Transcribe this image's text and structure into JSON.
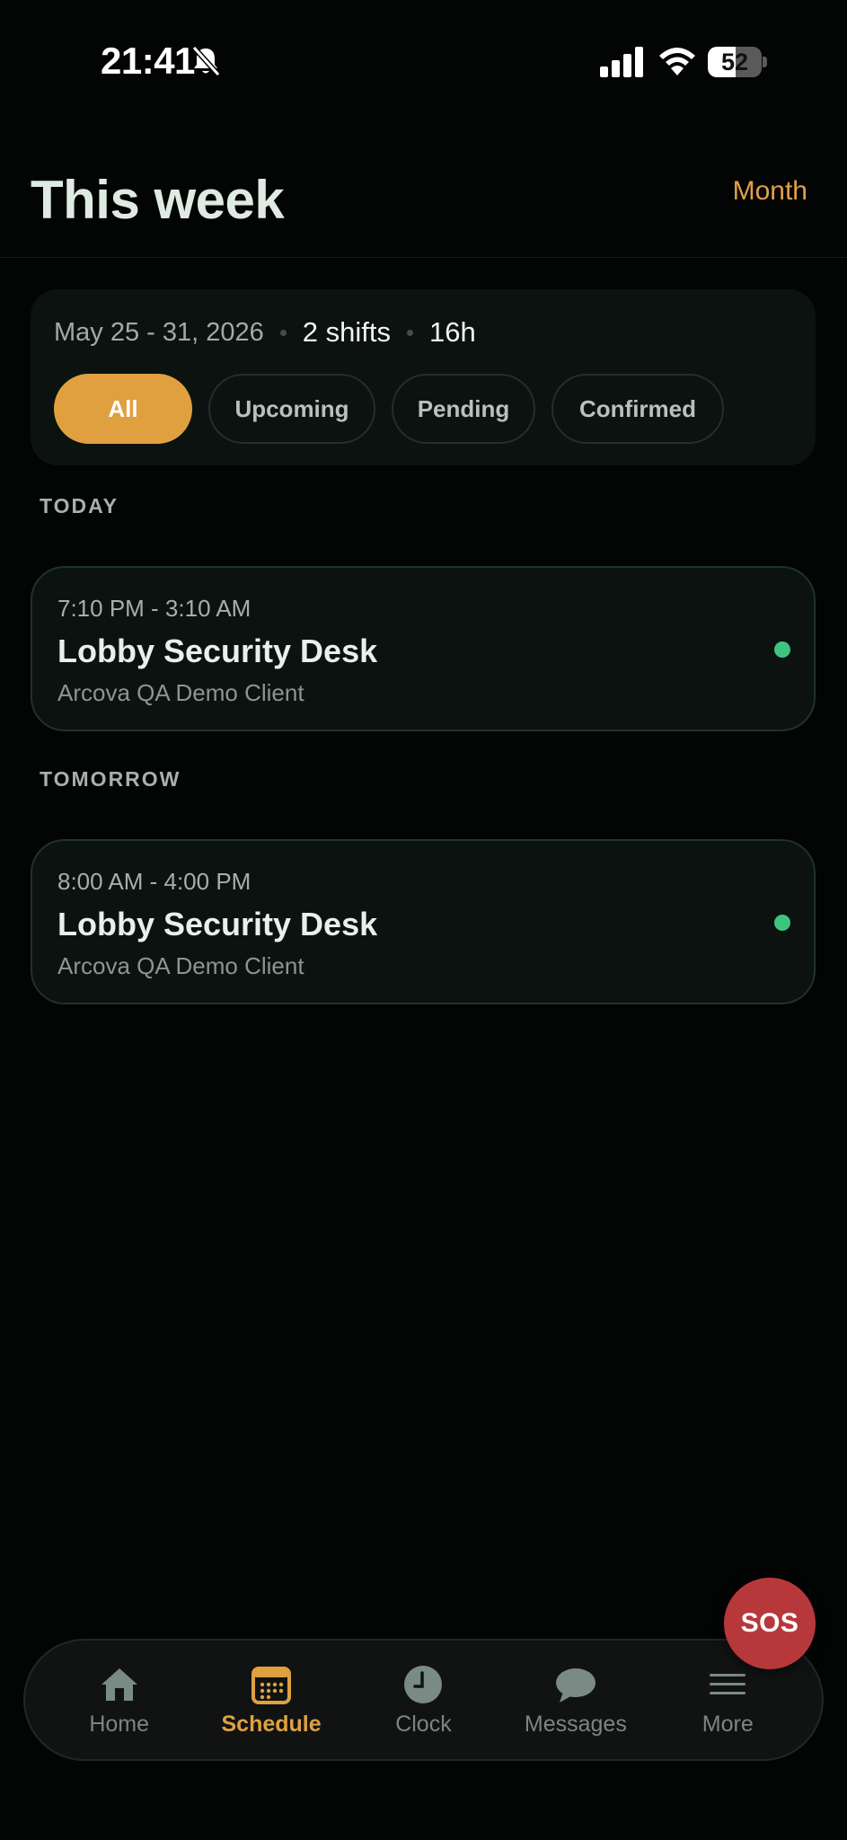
{
  "status_bar": {
    "time": "21:41",
    "battery": "52",
    "battery_level": 0.52
  },
  "header": {
    "title": "This week",
    "month_link": "Month"
  },
  "summary": {
    "date_range": "May 25 - 31, 2026",
    "shifts": "2 shifts",
    "hours": "16h",
    "filters": [
      {
        "label": "All",
        "active": true
      },
      {
        "label": "Upcoming",
        "active": false
      },
      {
        "label": "Pending",
        "active": false
      },
      {
        "label": "Confirmed",
        "active": false
      }
    ]
  },
  "sections": [
    {
      "label": "TODAY",
      "shift": {
        "time": "7:10 PM - 3:10 AM",
        "title": "Lobby Security Desk",
        "client": "Arcova QA Demo Client"
      }
    },
    {
      "label": "TOMORROW",
      "shift": {
        "time": "8:00 AM - 4:00 PM",
        "title": "Lobby Security Desk",
        "client": "Arcova QA Demo Client"
      }
    }
  ],
  "sos": {
    "label": "SOS"
  },
  "tabs": [
    {
      "label": "Home",
      "icon": "home-icon"
    },
    {
      "label": "Schedule",
      "icon": "calendar-icon",
      "active": true
    },
    {
      "label": "Clock",
      "icon": "clock-icon"
    },
    {
      "label": "Messages",
      "icon": "chat-bubble-icon"
    },
    {
      "label": "More",
      "icon": "menu-icon"
    }
  ],
  "colors": {
    "accent": "#e0a040",
    "status_ok": "#3fc47f",
    "sos": "#b7383b",
    "background": "#030404"
  }
}
